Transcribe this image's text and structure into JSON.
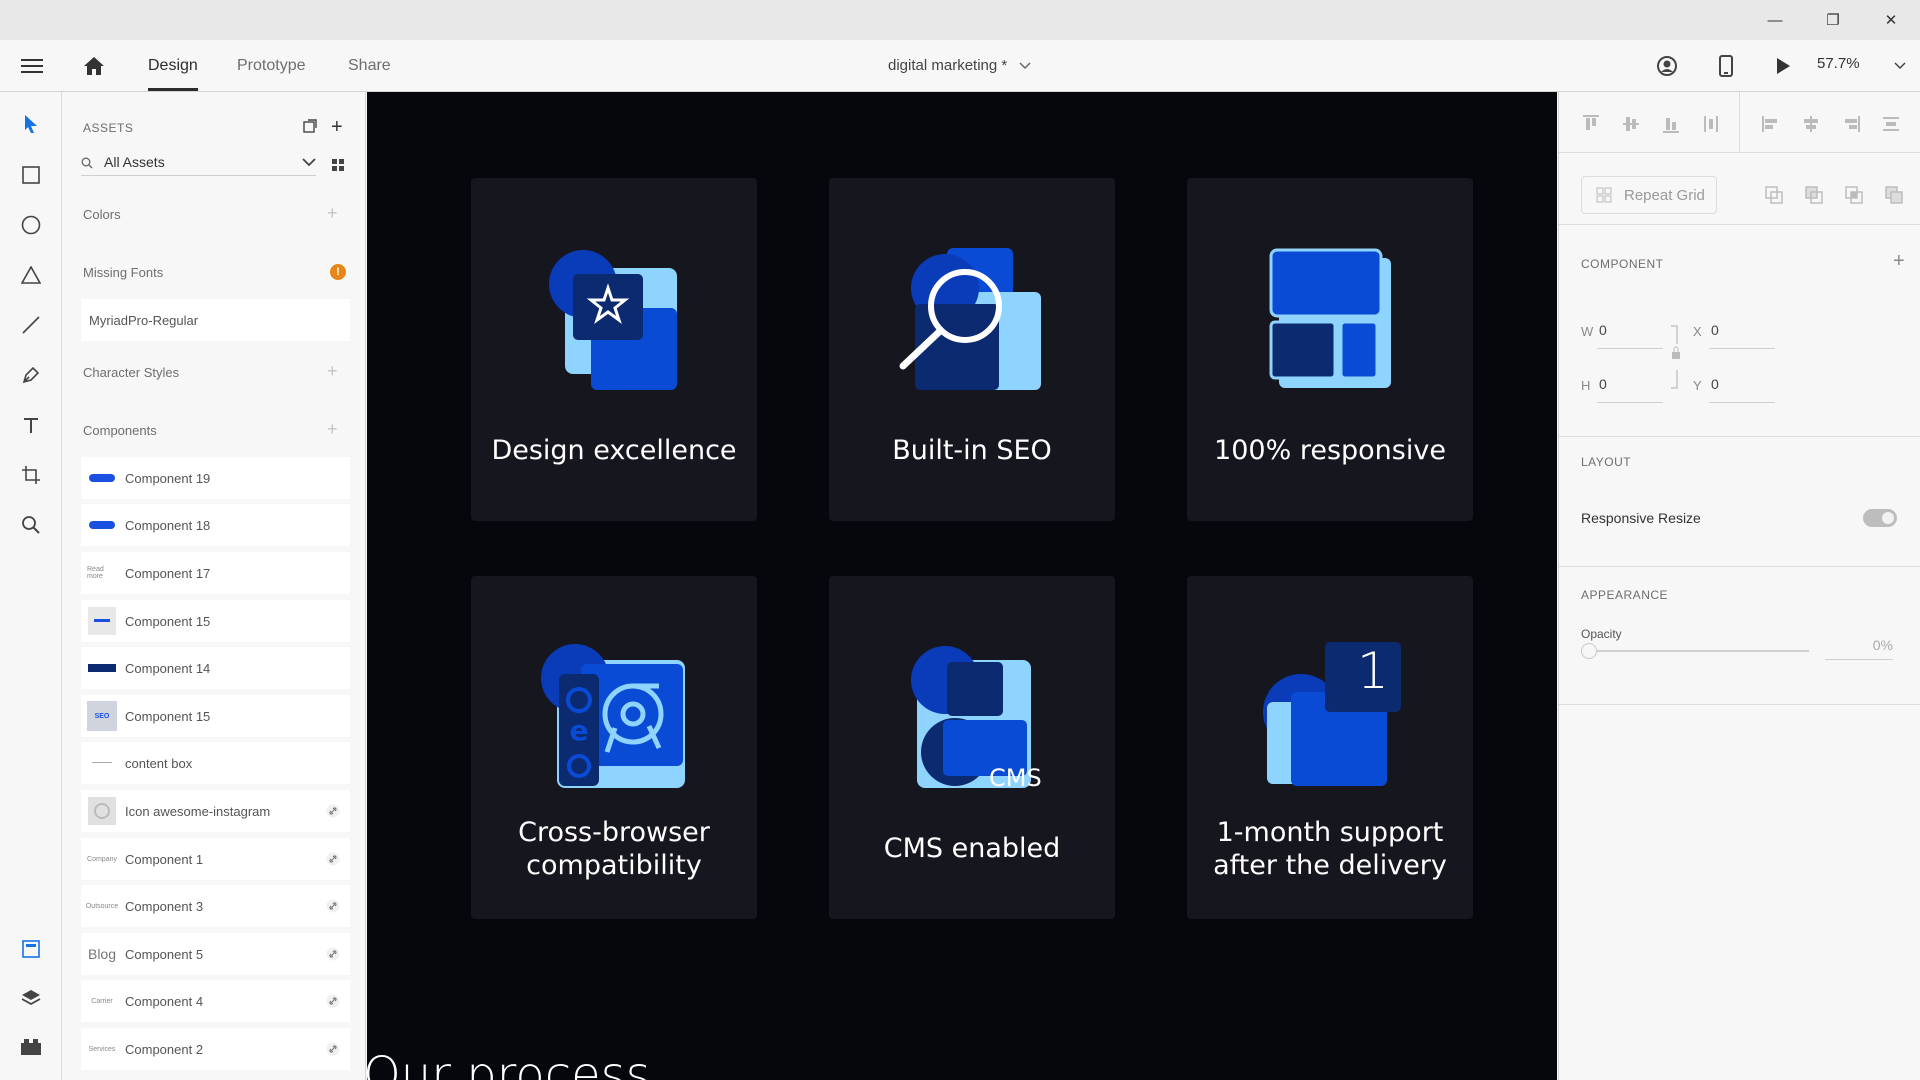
{
  "window": {
    "minimize_glyph": "—",
    "restore_glyph": "❐",
    "close_glyph": "✕"
  },
  "appbar": {
    "tabs": [
      {
        "label": "Design",
        "active": true
      },
      {
        "label": "Prototype",
        "active": false
      },
      {
        "label": "Share",
        "active": false
      }
    ],
    "document_title": "digital marketing *",
    "zoom": "57.7%"
  },
  "assets": {
    "header": "ASSETS",
    "search_value": "All Assets",
    "colors_label": "Colors",
    "missing_fonts_label": "Missing Fonts",
    "missing_fonts_badge": "!",
    "missing_font_item": "MyriadPro-Regular",
    "character_styles_label": "Character Styles",
    "components_label": "Components",
    "components": [
      {
        "label": "Component 19",
        "thumb": "",
        "linked": false
      },
      {
        "label": "Component 18",
        "thumb": "",
        "linked": false
      },
      {
        "label": "Component 17",
        "thumb": "Read more",
        "linked": false
      },
      {
        "label": "Component 15",
        "thumb": "",
        "linked": false
      },
      {
        "label": "Component 14",
        "thumb": "",
        "linked": false
      },
      {
        "label": "Component 15",
        "thumb": "SEO",
        "linked": false
      },
      {
        "label": "content box",
        "thumb": "",
        "linked": false
      },
      {
        "label": "Icon awesome-instagram",
        "thumb": "",
        "linked": true
      },
      {
        "label": "Component 1",
        "thumb": "Company",
        "linked": true
      },
      {
        "label": "Component 3",
        "thumb": "Outsource",
        "linked": true
      },
      {
        "label": "Component 5",
        "thumb": "Blog",
        "linked": true
      },
      {
        "label": "Component 4",
        "thumb": "Carrier",
        "linked": true
      },
      {
        "label": "Component 2",
        "thumb": "Services",
        "linked": true
      }
    ]
  },
  "canvas": {
    "cards": [
      {
        "label": "Design excellence",
        "icon": "star-icon"
      },
      {
        "label": "Built-in SEO",
        "icon": "magnifier-icon"
      },
      {
        "label": "100% responsive",
        "icon": "responsive-layout-icon"
      },
      {
        "label": "Cross-browser compatibility",
        "icon": "browsers-icon"
      },
      {
        "label": "CMS enabled",
        "icon": "cms-icon",
        "badge": "CMS"
      },
      {
        "label": "1-month support after the delivery",
        "icon": "support-icon",
        "badge": "1"
      }
    ],
    "section_heading": "Our process"
  },
  "properties": {
    "repeat_grid_label": "Repeat Grid",
    "component_header": "COMPONENT",
    "w_label": "W",
    "w_value": "0",
    "h_label": "H",
    "h_value": "0",
    "x_label": "X",
    "x_value": "0",
    "y_label": "Y",
    "y_value": "0",
    "layout_header": "LAYOUT",
    "responsive_resize_label": "Responsive Resize",
    "appearance_header": "APPEARANCE",
    "opacity_label": "Opacity",
    "opacity_value": "0%"
  },
  "colors": {
    "accent": "#1473e6",
    "icon_dark": "#0b2a6f",
    "icon_mid": "#0a4bd6",
    "icon_light": "#8fd3ff",
    "card_bg": "#16161f",
    "canvas_bg": "#05070d",
    "warning": "#e68619"
  }
}
